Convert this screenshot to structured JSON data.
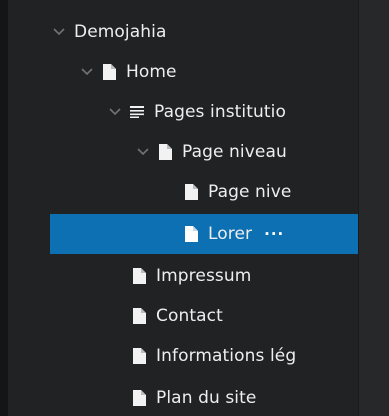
{
  "tree": {
    "items": [
      {
        "label": "Demojahia",
        "icon": "chevron-down-icon"
      },
      {
        "label": "Home",
        "icon": "document-icon"
      },
      {
        "label": "Pages institutio",
        "icon": "list-icon"
      },
      {
        "label": "Page niveau",
        "icon": "document-icon"
      },
      {
        "label": "Page nive",
        "icon": "document-icon"
      },
      {
        "label": "Lorer",
        "icon": "document-icon",
        "selected": true,
        "actions": "···"
      },
      {
        "label": "Impressum",
        "icon": "document-icon"
      },
      {
        "label": "Contact",
        "icon": "document-icon"
      },
      {
        "label": "Informations lég",
        "icon": "document-icon"
      },
      {
        "label": "Plan du site",
        "icon": "document-icon"
      }
    ]
  },
  "colors": {
    "background": "#202224",
    "selected": "#0d70b3",
    "text": "#eceef0"
  }
}
